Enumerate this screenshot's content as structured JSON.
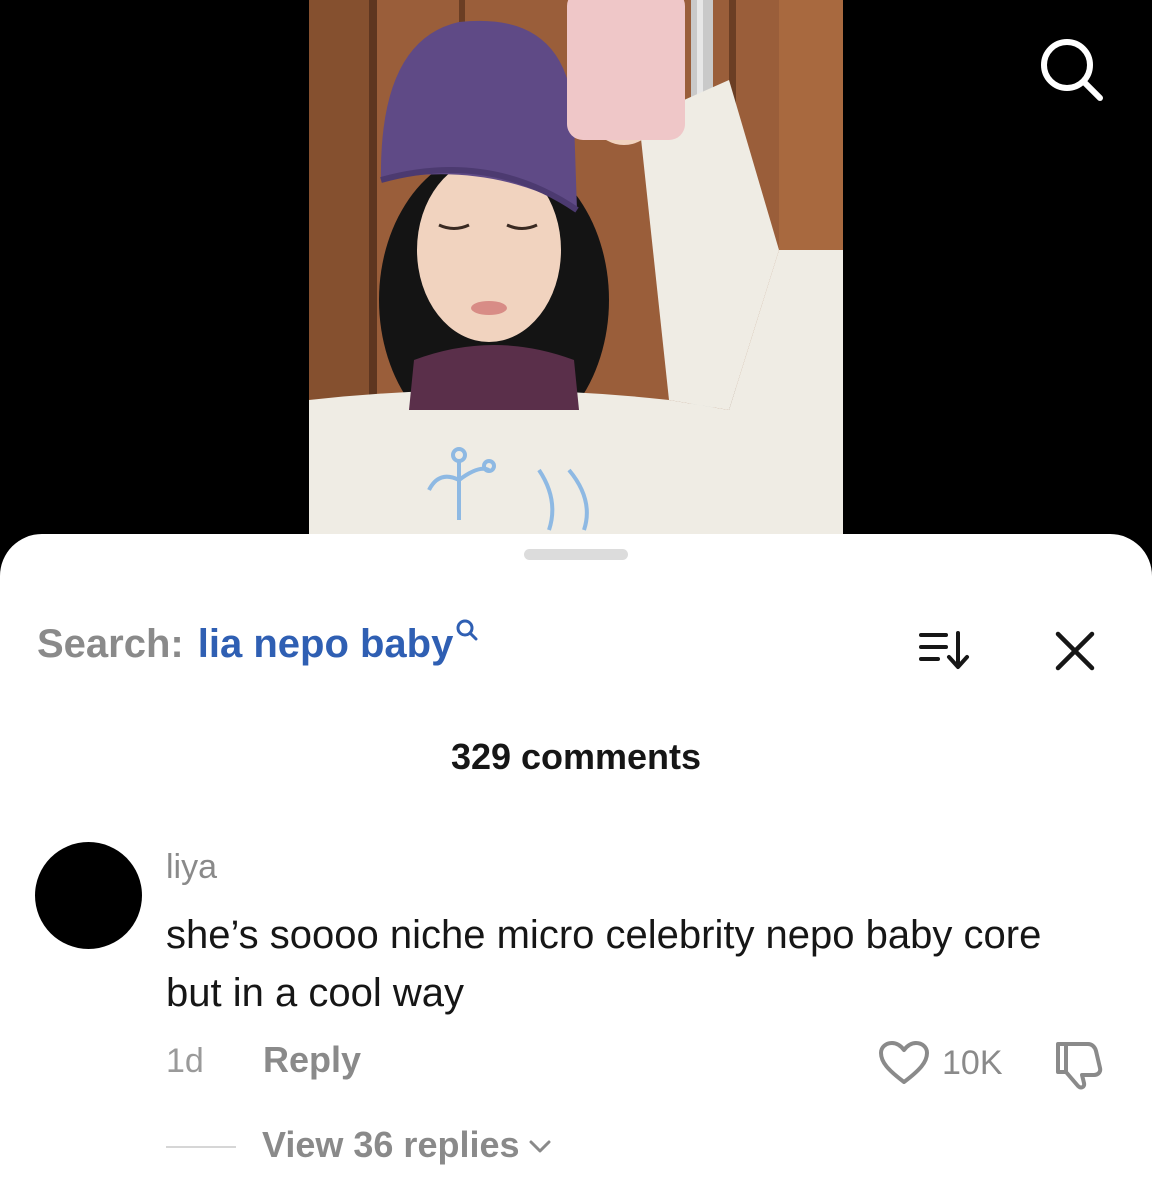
{
  "video": {
    "description_icon": "search-icon"
  },
  "search": {
    "prefix": "Search:",
    "query": "lia nepo baby"
  },
  "comments": {
    "count_label": "329 comments"
  },
  "comment": {
    "username": "liya",
    "text": "she’s soooo niche micro celebrity nepo baby core but in a cool way",
    "age": "1d",
    "reply_label": "Reply",
    "likes": "10K",
    "view_replies_label": "View 36 replies"
  },
  "colors": {
    "search_query": "#2f5fb3",
    "muted_text": "#8a8a8a",
    "primary_text": "#161616"
  }
}
